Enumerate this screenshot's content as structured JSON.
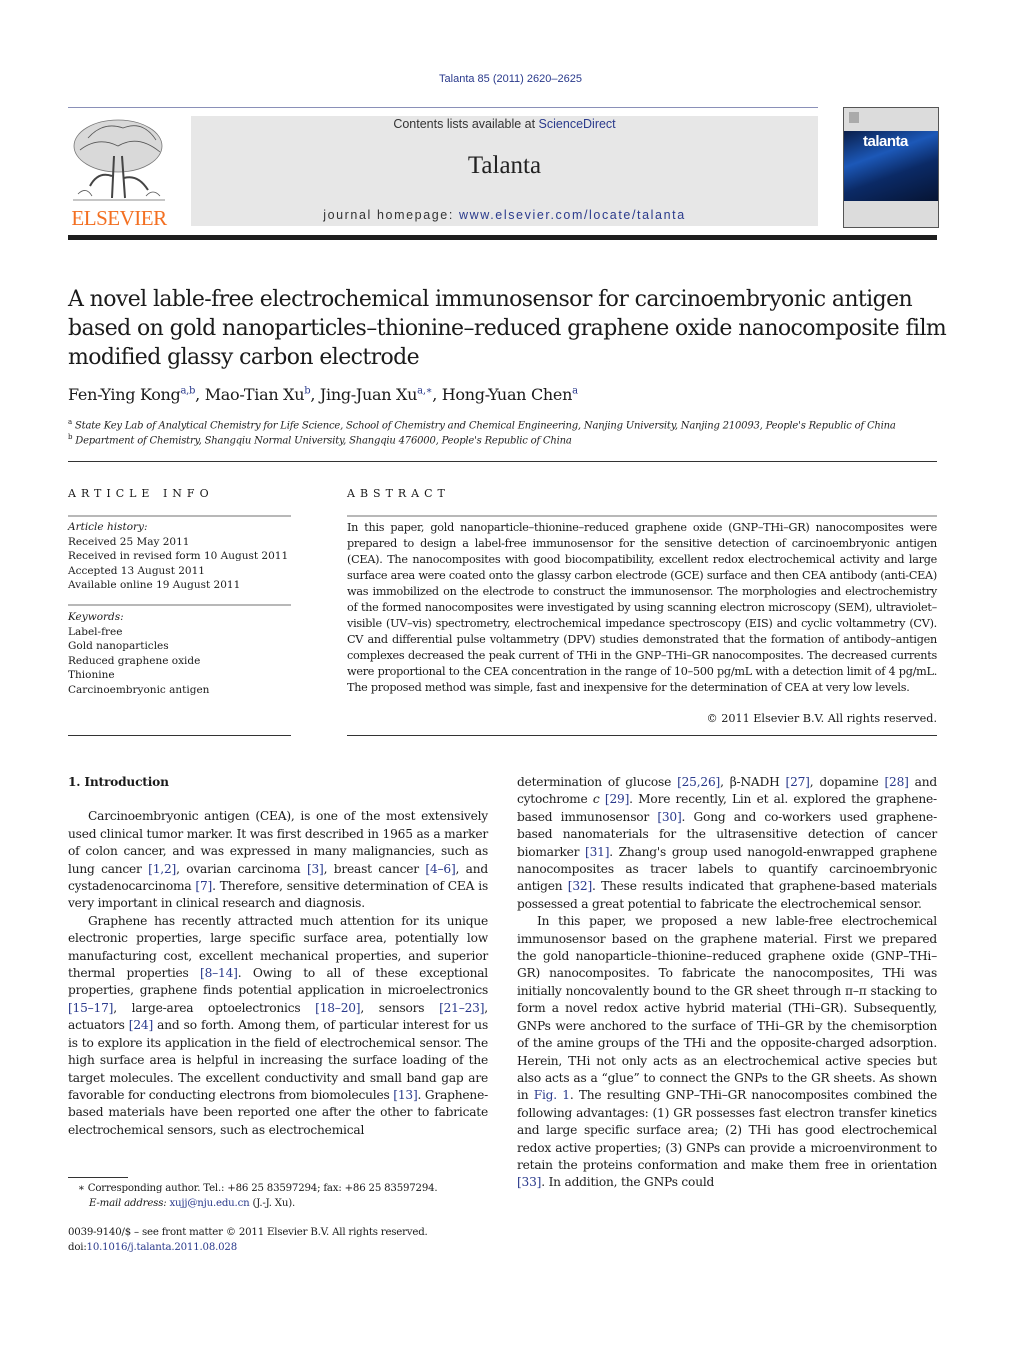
{
  "header": {
    "citation": "Talanta 85 (2011) 2620–2625",
    "contents_prefix": "Contents lists available at ",
    "contents_link": "ScienceDirect",
    "journal_name": "Talanta",
    "homepage_prefix": "journal homepage: ",
    "homepage_link": "www.elsevier.com/locate/talanta",
    "publisher_logo_text": "ELSEVIER",
    "cover_title": "talanta",
    "colors": {
      "elsevier_orange": "#f36f21",
      "link_blue": "#2a3a8c",
      "banner_grey": "#e7e7e7"
    }
  },
  "article": {
    "title": "A novel lable-free electrochemical immunosensor for carcinoembryonic antigen based on gold nanoparticles–thionine–reduced graphene oxide nanocomposite film modified glassy carbon electrode",
    "authors": [
      {
        "name": "Fen-Ying Kong",
        "sup": "a,b"
      },
      {
        "name": "Mao-Tian Xu",
        "sup": "b"
      },
      {
        "name": "Jing-Juan Xu",
        "sup": "a,∗"
      },
      {
        "name": "Hong-Yuan Chen",
        "sup": "a"
      }
    ],
    "affiliations": [
      {
        "sup": "a",
        "text": "State Key Lab of Analytical Chemistry for Life Science, School of Chemistry and Chemical Engineering, Nanjing University, Nanjing 210093, People's Republic of China"
      },
      {
        "sup": "b",
        "text": "Department of Chemistry, Shangqiu Normal University, Shangqiu 476000, People's Republic of China"
      }
    ]
  },
  "article_info": {
    "heading": "ARTICLE INFO",
    "history_label": "Article history:",
    "history": [
      "Received 25 May 2011",
      "Received in revised form 10 August 2011",
      "Accepted 13 August 2011",
      "Available online 19 August 2011"
    ],
    "keywords_label": "Keywords:",
    "keywords": [
      "Label-free",
      "Gold nanoparticles",
      "Reduced graphene oxide",
      "Thionine",
      "Carcinoembryonic antigen"
    ]
  },
  "abstract": {
    "heading": "ABSTRACT",
    "text": "In this paper, gold nanoparticle–thionine–reduced graphene oxide (GNP–THi–GR) nanocomposites were prepared to design a label-free immunosensor for the sensitive detection of carcinoembryonic antigen (CEA). The nanocomposites with good biocompatibility, excellent redox electrochemical activity and large surface area were coated onto the glassy carbon electrode (GCE) surface and then CEA antibody (anti-CEA) was immobilized on the electrode to construct the immunosensor. The morphologies and electrochemistry of the formed nanocomposites were investigated by using scanning electron microscopy (SEM), ultraviolet–visible (UV–vis) spectrometry, electrochemical impedance spectroscopy (EIS) and cyclic voltammetry (CV). CV and differential pulse voltammetry (DPV) studies demonstrated that the formation of antibody–antigen complexes decreased the peak current of THi in the GNP–THi–GR nanocomposites. The decreased currents were proportional to the CEA concentration in the range of 10–500 pg/mL with a detection limit of 4 pg/mL. The proposed method was simple, fast and inexpensive for the determination of CEA at very low levels.",
    "copyright": "© 2011 Elsevier B.V. All rights reserved."
  },
  "body": {
    "section_heading": "1.  Introduction",
    "left_paragraphs": [
      [
        {
          "t": "Carcinoembryonic antigen (CEA), is one of the most extensively used clinical tumor marker. It was first described in 1965 as a marker of colon cancer, and was expressed in many malignancies, such as lung cancer "
        },
        {
          "r": "[1,2]"
        },
        {
          "t": ", ovarian carcinoma "
        },
        {
          "r": "[3]"
        },
        {
          "t": ", breast cancer "
        },
        {
          "r": "[4–6]"
        },
        {
          "t": ", and cystadenocarcinoma "
        },
        {
          "r": "[7]"
        },
        {
          "t": ". Therefore, sensitive determination of CEA is very important in clinical research and diagnosis."
        }
      ],
      [
        {
          "t": "Graphene has recently attracted much attention for its unique electronic properties, large specific surface area, potentially low manufacturing cost, excellent mechanical properties, and superior thermal properties "
        },
        {
          "r": "[8–14]"
        },
        {
          "t": ". Owing to all of these exceptional properties, graphene finds potential application in microelectronics "
        },
        {
          "r": "[15–17]"
        },
        {
          "t": ", large-area optoelectronics "
        },
        {
          "r": "[18–20]"
        },
        {
          "t": ", sensors "
        },
        {
          "r": "[21–23]"
        },
        {
          "t": ", actuators "
        },
        {
          "r": "[24]"
        },
        {
          "t": " and so forth. Among them, of particular interest for us is to explore its application in the field of electrochemical sensor. The high surface area is helpful in increasing the surface loading of the target molecules. The excellent conductivity and small band gap are favorable for conducting electrons from biomolecules "
        },
        {
          "r": "[13]"
        },
        {
          "t": ". Graphene-based materials have been reported one after the other to fabricate electrochemical sensors, such as electrochemical"
        }
      ]
    ],
    "right_paragraphs": [
      [
        {
          "t": "determination of glucose "
        },
        {
          "r": "[25,26]"
        },
        {
          "t": ", β-NADH "
        },
        {
          "r": "[27]"
        },
        {
          "t": ", dopamine "
        },
        {
          "r": "[28]"
        },
        {
          "t": " and cytochrome "
        },
        {
          "i": "c"
        },
        {
          "t": " "
        },
        {
          "r": "[29]"
        },
        {
          "t": ". More recently, Lin et al. explored the graphene-based immunosensor "
        },
        {
          "r": "[30]"
        },
        {
          "t": ". Gong and co-workers used graphene-based nanomaterials for the ultrasensitive detection of cancer biomarker "
        },
        {
          "r": "[31]"
        },
        {
          "t": ". Zhang's group used nanogold-enwrapped graphene nanocomposites as tracer labels to quantify carcinoembryonic antigen "
        },
        {
          "r": "[32]"
        },
        {
          "t": ". These results indicated that graphene-based materials possessed a great potential to fabricate the electrochemical sensor."
        }
      ],
      [
        {
          "t": "In this paper, we proposed a new lable-free electrochemical immunosensor based on the graphene material. First we prepared the gold nanoparticle–thionine–reduced graphene oxide (GNP–THi–GR) nanocomposites. To fabricate the nanocomposites, THi was initially noncovalently bound to the GR sheet through π–π stacking to form a novel redox active hybrid material (THi–GR). Subsequently, GNPs were anchored to the surface of THi–GR by the chemisorption of the amine groups of the THi and the opposite-charged adsorption. Herein, THi not only acts as an electrochemical active species but also acts as a “glue” to connect the GNPs to the GR sheets. As shown in "
        },
        {
          "r": "Fig. 1"
        },
        {
          "t": ". The resulting GNP–THi–GR nanocomposites combined the following advantages: (1) GR possesses fast electron transfer kinetics and large specific surface area; (2) THi has good electrochemical redox active properties; (3) GNPs can provide a microenvironment to retain the proteins conformation and make them free in orientation "
        },
        {
          "r": "[33]"
        },
        {
          "t": ". In addition, the GNPs could"
        }
      ]
    ]
  },
  "footnote": {
    "marker": "∗",
    "corresponding": "Corresponding author. Tel.: +86 25 83597294; fax: +86 25 83597294.",
    "email_label": "E-mail address: ",
    "email": "xujj@nju.edu.cn",
    "email_suffix": " (J.-J. Xu).",
    "frontmatter": "0039-9140/$ – see front matter © 2011 Elsevier B.V. All rights reserved.",
    "doi_label": "doi:",
    "doi": "10.1016/j.talanta.2011.08.028"
  }
}
